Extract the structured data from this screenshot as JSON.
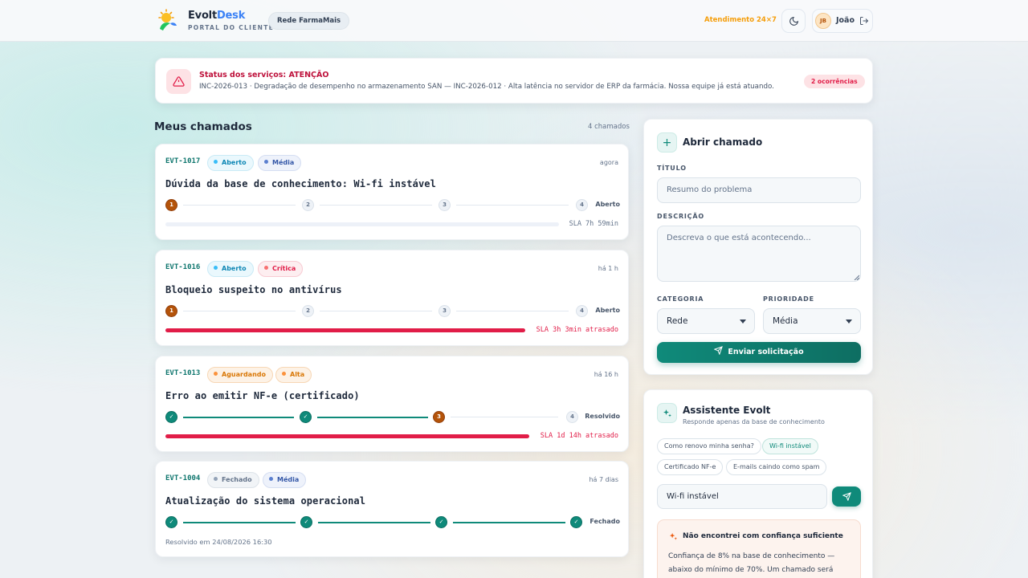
{
  "header": {
    "brand_a": "Evolt",
    "brand_b": "Desk",
    "brand_sub": "PORTAL DO CLIENTE",
    "org": "Rede FarmaMais",
    "support": "Atendimento 24×7",
    "user_initials": "JB",
    "user_name": "João"
  },
  "alert": {
    "title": "Status dos serviços: ATENÇÃO",
    "text": "INC-2026-013 · Degradação de desempenho no armazenamento SAN — INC-2026-012 · Alta latência no servidor de ERP da farmácia. Nossa equipe já está atuando.",
    "badge": "2 ocorrências"
  },
  "list": {
    "title": "Meus chamados",
    "count": "4 chamados",
    "tickets": [
      {
        "id": "EVT-1017",
        "status": "Aberto",
        "priority": "Média",
        "time": "agora",
        "title": "Dúvida da base de conhecimento: Wi-fi instável",
        "steps": [
          "1",
          "2",
          "3",
          "4"
        ],
        "step_status": "Aberto",
        "sla": "SLA 7h 59min",
        "sla_fraction": 0.0
      },
      {
        "id": "EVT-1016",
        "status": "Aberto",
        "priority": "Crítica",
        "time": "há 1 h",
        "title": "Bloqueio suspeito no antivírus",
        "steps": [
          "1",
          "2",
          "3",
          "4"
        ],
        "step_status": "Aberto",
        "sla": "SLA 3h 3min atrasado",
        "sla_fraction": 1.0
      },
      {
        "id": "EVT-1013",
        "status": "Aguardando",
        "priority": "Alta",
        "time": "há 16 h",
        "title": "Erro ao emitir NF-e (certificado)",
        "steps": [
          "✓",
          "✓",
          "3",
          "4"
        ],
        "step_status": "Resolvido",
        "sla": "SLA 1d 14h atrasado",
        "sla_fraction": 1.0
      },
      {
        "id": "EVT-1004",
        "status": "Fechado",
        "priority": "Média",
        "time": "há 7 dias",
        "title": "Atualização do sistema operacional",
        "steps": [
          "✓",
          "✓",
          "✓",
          "✓"
        ],
        "step_status": "Fechado",
        "resolved": "Resolvido em 24/08/2026 16:30"
      }
    ]
  },
  "form": {
    "icon": "+",
    "title": "Abrir chamado",
    "title_label": "TÍTULO",
    "title_placeholder": "Resumo do problema",
    "desc_label": "DESCRIÇÃO",
    "desc_placeholder": "Descreva o que está acontecendo...",
    "category_label": "CATEGORIA",
    "category_value": "Rede",
    "priority_label": "PRIORIDADE",
    "priority_value": "Média",
    "submit": "Enviar solicitação"
  },
  "assistant": {
    "title": "Assistente Evolt",
    "subtitle": "Responde apenas da base de conhecimento",
    "chips": [
      "Como renovo minha senha?",
      "Wi-fi instável",
      "Certificado NF-e",
      "E-mails caindo como spam"
    ],
    "input_value": "Wi-fi instável",
    "reply_title": "Não encontrei com confiança suficiente",
    "reply_text": "Confiança de 8% na base de conhecimento — abaixo do mínimo de 70%. Um chamado será"
  },
  "colors": {
    "teal": "#0f8a7a",
    "danger": "#e11d48",
    "warning": "#f59e0b",
    "current_step": "#b45309"
  }
}
